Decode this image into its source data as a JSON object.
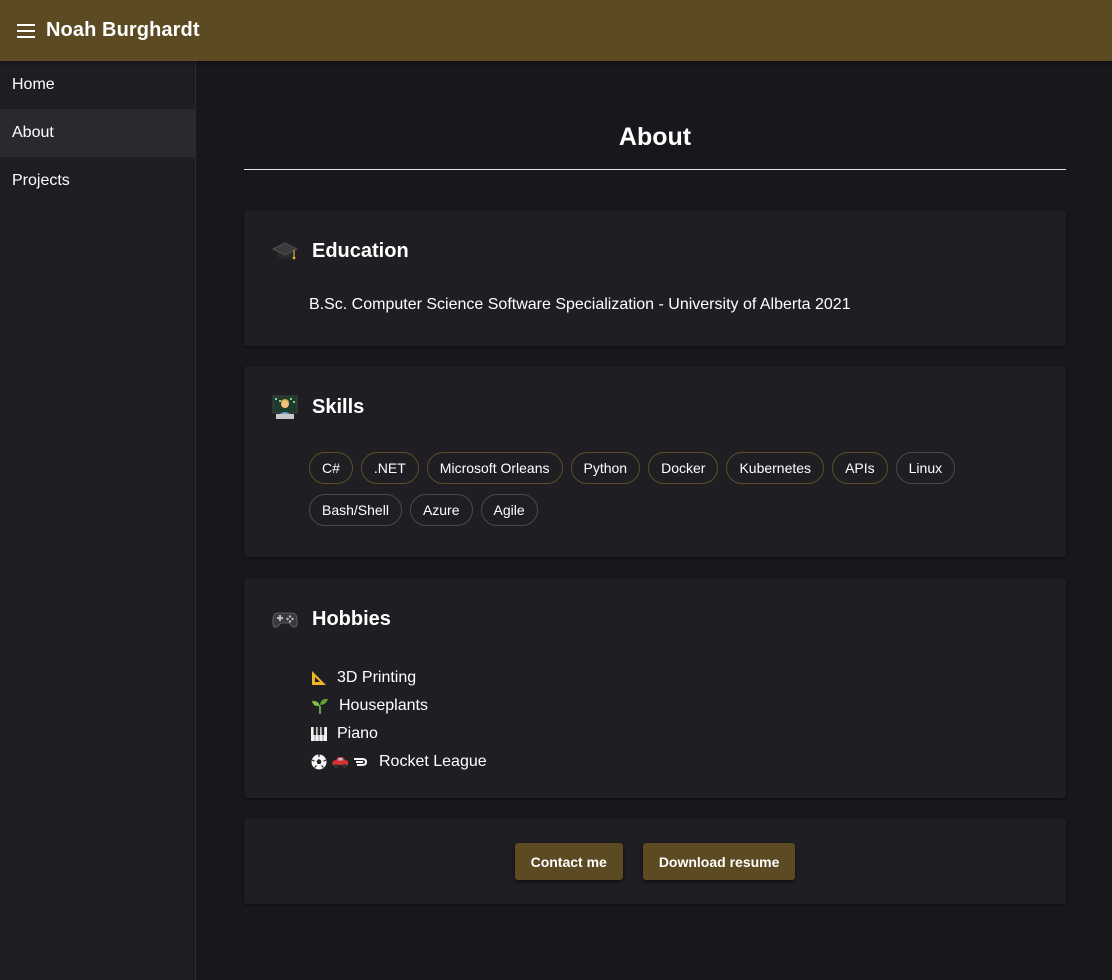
{
  "appbar": {
    "title": "Noah Burghardt"
  },
  "sidebar": {
    "items": [
      {
        "label": "Home"
      },
      {
        "label": "About"
      },
      {
        "label": "Projects"
      }
    ]
  },
  "page": {
    "title": "About"
  },
  "education": {
    "title": "Education",
    "icon": "graduation-cap-icon",
    "text": "B.Sc. Computer Science Software Specialization - University of Alberta 2021"
  },
  "skills": {
    "title": "Skills",
    "icon": "technologist-icon",
    "chips": [
      "C#",
      ".NET",
      "Microsoft Orleans",
      "Python",
      "Docker",
      "Kubernetes",
      "APIs",
      "Linux",
      "Bash/Shell",
      "Azure",
      "Agile"
    ]
  },
  "hobbies": {
    "title": "Hobbies",
    "icon": "game-controller-icon",
    "items": [
      {
        "label": "3D Printing",
        "icons": [
          "triangular-ruler-icon"
        ]
      },
      {
        "label": "Houseplants",
        "icons": [
          "seedling-icon"
        ]
      },
      {
        "label": "Piano",
        "icons": [
          "piano-keys-icon"
        ]
      },
      {
        "label": "Rocket League",
        "icons": [
          "soccer-ball-icon",
          "car-icon",
          "dash-icon"
        ]
      }
    ]
  },
  "actions": {
    "contact_label": "Contact me",
    "resume_label": "Download resume"
  },
  "colors": {
    "accent": "#5b4a22",
    "background": "#18171b",
    "card": "#1f1e23",
    "sidebar": "#1e1d22"
  }
}
